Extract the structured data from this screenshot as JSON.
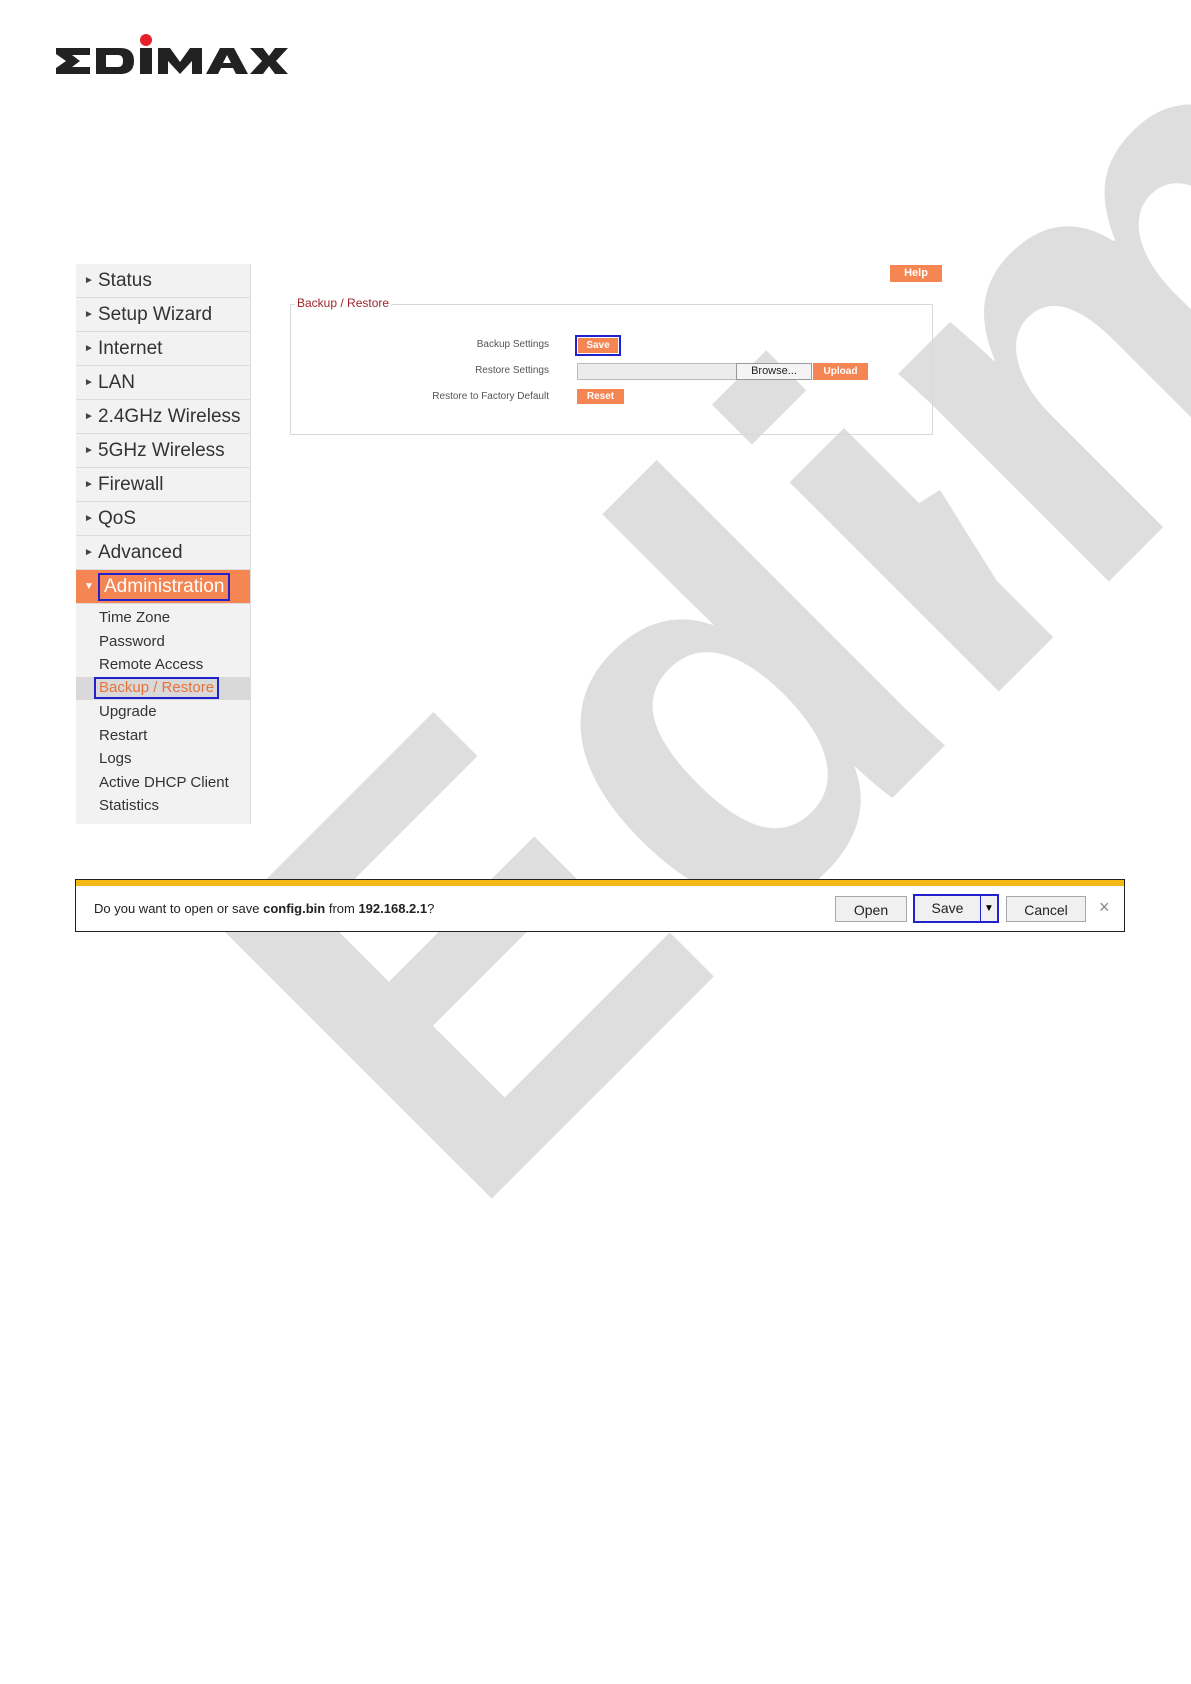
{
  "brand": {
    "logo_text": "EDIMAX",
    "accent_color": "#f58553",
    "logo_dot_color": "#e4202a"
  },
  "watermark": {
    "text": "Edimax"
  },
  "router_ui": {
    "help_label": "Help",
    "sidebar": {
      "items": [
        {
          "label": "Status"
        },
        {
          "label": "Setup Wizard"
        },
        {
          "label": "Internet"
        },
        {
          "label": "LAN"
        },
        {
          "label": "2.4GHz Wireless"
        },
        {
          "label": "5GHz Wireless"
        },
        {
          "label": "Firewall"
        },
        {
          "label": "QoS"
        },
        {
          "label": "Advanced"
        }
      ],
      "active": {
        "label": "Administration"
      },
      "subitems": [
        {
          "label": "Time Zone"
        },
        {
          "label": "Password"
        },
        {
          "label": "Remote Access"
        },
        {
          "label": "Backup / Restore"
        },
        {
          "label": "Upgrade"
        },
        {
          "label": "Restart"
        },
        {
          "label": "Logs"
        },
        {
          "label": "Active DHCP Client"
        },
        {
          "label": "Statistics"
        }
      ]
    },
    "panel": {
      "title": "Backup / Restore",
      "backup_label": "Backup Settings",
      "save_button": "Save",
      "restore_label": "Restore Settings",
      "browse_button": "Browse...",
      "upload_button": "Upload",
      "factory_label": "Restore to Factory Default",
      "reset_button": "Reset"
    }
  },
  "download_bar": {
    "prompt_start": "Do you want to open or save ",
    "filename": "config.bin",
    "prompt_mid": " from ",
    "host": "192.168.2.1",
    "prompt_end": "?",
    "open_button": "Open",
    "save_button": "Save",
    "cancel_button": "Cancel",
    "close_icon": "×",
    "stripe_color": "#f5b916"
  }
}
